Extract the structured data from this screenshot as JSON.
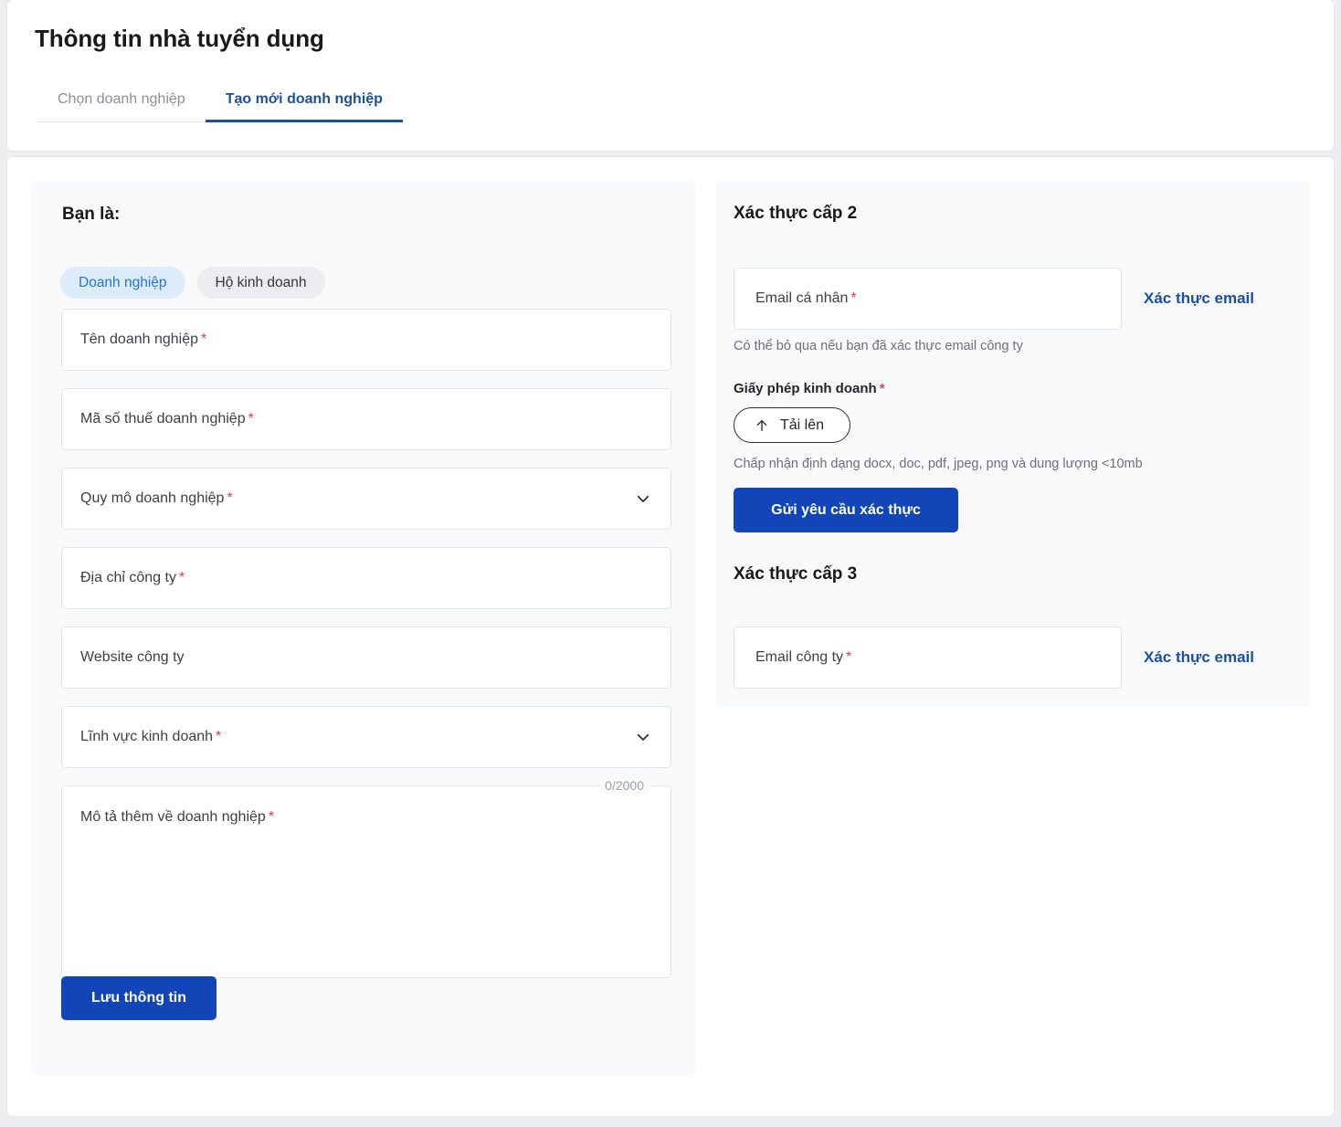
{
  "header": {
    "title": "Thông tin nhà tuyển dụng",
    "tabs": [
      {
        "label": "Chọn doanh nghiệp",
        "active": false
      },
      {
        "label": "Tạo mới doanh nghiệp",
        "active": true
      }
    ]
  },
  "left_panel": {
    "heading": "Bạn là:",
    "chips": [
      {
        "label": "Doanh nghiệp",
        "selected": true
      },
      {
        "label": "Hộ kinh doanh",
        "selected": false
      }
    ],
    "fields": [
      {
        "label": "Tên doanh nghiệp",
        "required": true,
        "type": "text",
        "value": ""
      },
      {
        "label": "Mã số thuế doanh nghiệp",
        "required": true,
        "type": "text",
        "value": ""
      },
      {
        "label": "Quy mô doanh nghiệp",
        "required": true,
        "type": "select",
        "value": ""
      },
      {
        "label": "Địa chỉ công ty",
        "required": true,
        "type": "text",
        "value": ""
      },
      {
        "label": "Website công ty",
        "required": false,
        "type": "text",
        "value": ""
      },
      {
        "label": "Lĩnh vực kinh doanh",
        "required": true,
        "type": "select",
        "value": ""
      }
    ],
    "textarea": {
      "label": "Mô tả thêm về doanh nghiệp",
      "required": true,
      "value": "",
      "counter": "0/2000"
    },
    "save_label": "Lưu thông tin"
  },
  "right_panel": {
    "level2": {
      "heading": "Xác thực cấp 2",
      "email_label": "Email cá nhân",
      "email_value": "",
      "verify_label": "Xác thực email",
      "hint": "Có thể bỏ qua nếu bạn đã xác thực email công ty",
      "license_label": "Giấy phép kinh doanh",
      "upload_label": "Tải lên",
      "upload_hint": "Chấp nhận định dạng docx, doc, pdf, jpeg, png và dung lượng <10mb",
      "submit_label": "Gửi yêu cầu xác thực"
    },
    "level3": {
      "heading": "Xác thực cấp 3",
      "email_label": "Email công ty",
      "email_value": "",
      "verify_label": "Xác thực email"
    }
  },
  "colors": {
    "primary_blue": "#1145b8",
    "tab_blue": "#1b4fa0",
    "chip_selected_bg": "#ddecfb",
    "chip_selected_text": "#2775d4",
    "required_red": "#e0394a",
    "panel_bg": "#f8f9fb",
    "page_bg": "#eceef1"
  },
  "symbols": {
    "required_mark": "*"
  }
}
